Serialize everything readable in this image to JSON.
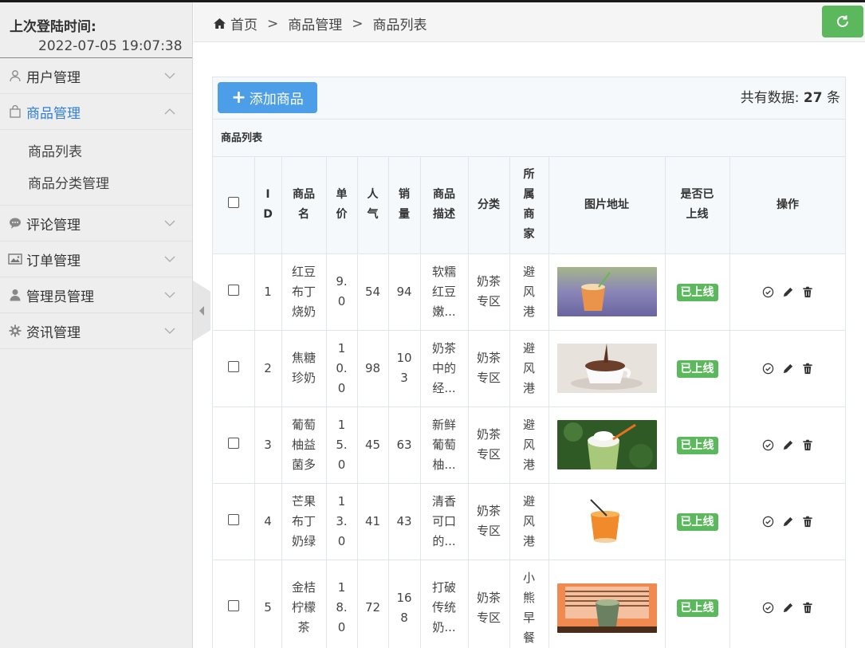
{
  "sidebar": {
    "last_login_label": "上次登陆时间:",
    "last_login_value": "2022-07-05 19:07:38",
    "menu": [
      {
        "label": "用户管理",
        "icon": "user-icon"
      },
      {
        "label": "商品管理",
        "icon": "shopping-bag-icon",
        "active": true
      },
      {
        "label": "评论管理",
        "icon": "comment-icon"
      },
      {
        "label": "订单管理",
        "icon": "picture-icon"
      },
      {
        "label": "管理员管理",
        "icon": "admin-user-icon"
      },
      {
        "label": "资讯管理",
        "icon": "gear-icon"
      }
    ],
    "submenu": [
      "商品列表",
      "商品分类管理"
    ]
  },
  "breadcrumb": {
    "home": "首页",
    "items": [
      "商品管理",
      "商品列表"
    ],
    "separator": ">"
  },
  "toolbar": {
    "add_label": "添加商品",
    "total_prefix": "共有数据:",
    "total_count": "27",
    "total_suffix": "条"
  },
  "table": {
    "title": "商品列表",
    "headers": [
      "I\nD",
      "商品\n名",
      "单\n价",
      "人\n气",
      "销\n量",
      "商品\n描述",
      "分类",
      "所\n属\n商\n家",
      "图片地址",
      "是否已\n上线",
      "操作"
    ],
    "rows": [
      {
        "id": "1",
        "name": "红豆\n布丁\n烧奶",
        "price": "9.\n0",
        "popularity": "54",
        "sales": "94",
        "desc": "软糯\n红豆\n嫩...",
        "category": "奶茶\n专区",
        "merchant": "避\n风\n港",
        "image": "cup-purple",
        "status": "已上线"
      },
      {
        "id": "2",
        "name": "焦糖\n珍奶",
        "price": "1\n0.\n0",
        "popularity": "98",
        "sales": "10\n3",
        "desc": "奶茶\n中的\n经...",
        "category": "奶茶\n专区",
        "merchant": "避\n风\n港",
        "image": "cup-chocolate",
        "status": "已上线"
      },
      {
        "id": "3",
        "name": "葡萄\n柚益\n菌多",
        "price": "1\n5.\n0",
        "popularity": "45",
        "sales": "63",
        "desc": "新鲜\n葡萄\n柚...",
        "category": "奶茶\n专区",
        "merchant": "避\n风\n港",
        "image": "cup-green",
        "status": "已上线"
      },
      {
        "id": "4",
        "name": "芒果\n布丁\n奶绿",
        "price": "1\n3.\n0",
        "popularity": "41",
        "sales": "43",
        "desc": "清香\n可口\n的...",
        "category": "奶茶\n专区",
        "merchant": "避\n风\n港",
        "image": "cup-orange",
        "status": "已上线"
      },
      {
        "id": "5",
        "name": "金桔\n柠檬\n茶",
        "price": "1\n8.\n0",
        "popularity": "72",
        "sales": "16\n8",
        "desc": "打破\n传统\n奶...",
        "category": "奶茶\n专区",
        "merchant": "小\n熊\n早\n餐",
        "image": "cup-window",
        "status": "已上线"
      }
    ]
  },
  "colors": {
    "accent": "#2f7fd5",
    "primary_btn": "#4c9ee8",
    "success": "#5cb85c"
  }
}
